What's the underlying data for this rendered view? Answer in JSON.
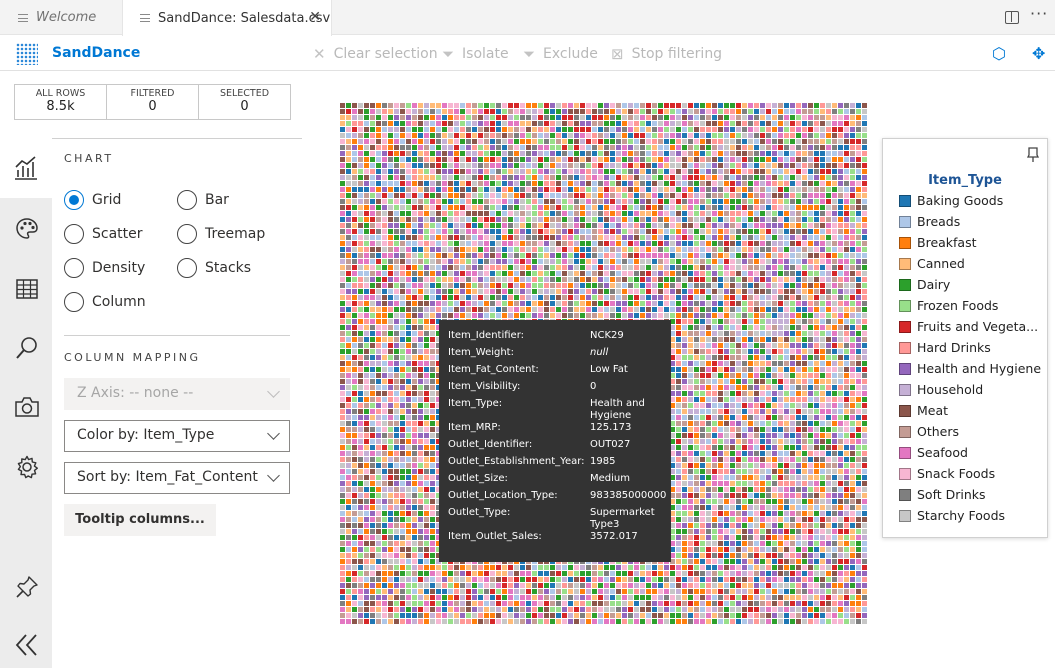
{
  "tabs": [
    {
      "label": "Welcome",
      "active": false
    },
    {
      "label": "SandDance: Salesdata.csv",
      "active": true
    }
  ],
  "toolbar": {
    "brand": "SandDance",
    "clear_selection": "Clear selection",
    "isolate": "Isolate",
    "exclude": "Exclude",
    "stop_filtering": "Stop filtering"
  },
  "counts": {
    "all_rows_label": "ALL ROWS",
    "all_rows": "8.5k",
    "filtered_label": "FILTERED",
    "filtered": "0",
    "selected_label": "SELECTED",
    "selected": "0"
  },
  "chart": {
    "section_label": "CHART",
    "types": [
      "Grid",
      "Bar",
      "Scatter",
      "Treemap",
      "Density",
      "Stacks",
      "Column"
    ],
    "selected_type": "Grid"
  },
  "mapping": {
    "section_label": "COLUMN MAPPING",
    "z_axis": "Z Axis: -- none --",
    "color_by": "Color by: Item_Type",
    "sort_by": "Sort by: Item_Fat_Content",
    "tooltip_button": "Tooltip columns..."
  },
  "tooltip": [
    {
      "key": "Item_Identifier:",
      "value": "NCK29"
    },
    {
      "key": "Item_Weight:",
      "value": "null"
    },
    {
      "key": "Item_Fat_Content:",
      "value": "Low Fat"
    },
    {
      "key": "Item_Visibility:",
      "value": "0"
    },
    {
      "key": "Item_Type:",
      "value": "Health and Hygiene"
    },
    {
      "key": "Item_MRP:",
      "value": "125.173"
    },
    {
      "key": "Outlet_Identifier:",
      "value": "OUT027"
    },
    {
      "key": "Outlet_Establishment_Year:",
      "value": "1985"
    },
    {
      "key": "Outlet_Size:",
      "value": "Medium"
    },
    {
      "key": "Outlet_Location_Type:",
      "value": "983385000000"
    },
    {
      "key": "Outlet_Type:",
      "value": "Supermarket Type3"
    },
    {
      "key": "Item_Outlet_Sales:",
      "value": "3572.017"
    }
  ],
  "legend": {
    "title": "Item_Type",
    "items": [
      {
        "label": "Baking Goods",
        "color": "#1f77b4"
      },
      {
        "label": "Breads",
        "color": "#aec7e8"
      },
      {
        "label": "Breakfast",
        "color": "#ff7f0e"
      },
      {
        "label": "Canned",
        "color": "#ffbb78"
      },
      {
        "label": "Dairy",
        "color": "#2ca02c"
      },
      {
        "label": "Frozen Foods",
        "color": "#98df8a"
      },
      {
        "label": "Fruits and Vegeta...",
        "color": "#d62728"
      },
      {
        "label": "Hard Drinks",
        "color": "#ff9896"
      },
      {
        "label": "Health and Hygiene",
        "color": "#9467bd"
      },
      {
        "label": "Household",
        "color": "#c5b0d5"
      },
      {
        "label": "Meat",
        "color": "#8c564b"
      },
      {
        "label": "Others",
        "color": "#c49c94"
      },
      {
        "label": "Seafood",
        "color": "#e377c2"
      },
      {
        "label": "Snack Foods",
        "color": "#f7b6d2"
      },
      {
        "label": "Soft Drinks",
        "color": "#7f7f7f"
      },
      {
        "label": "Starchy Foods",
        "color": "#c7c7c7"
      }
    ]
  }
}
